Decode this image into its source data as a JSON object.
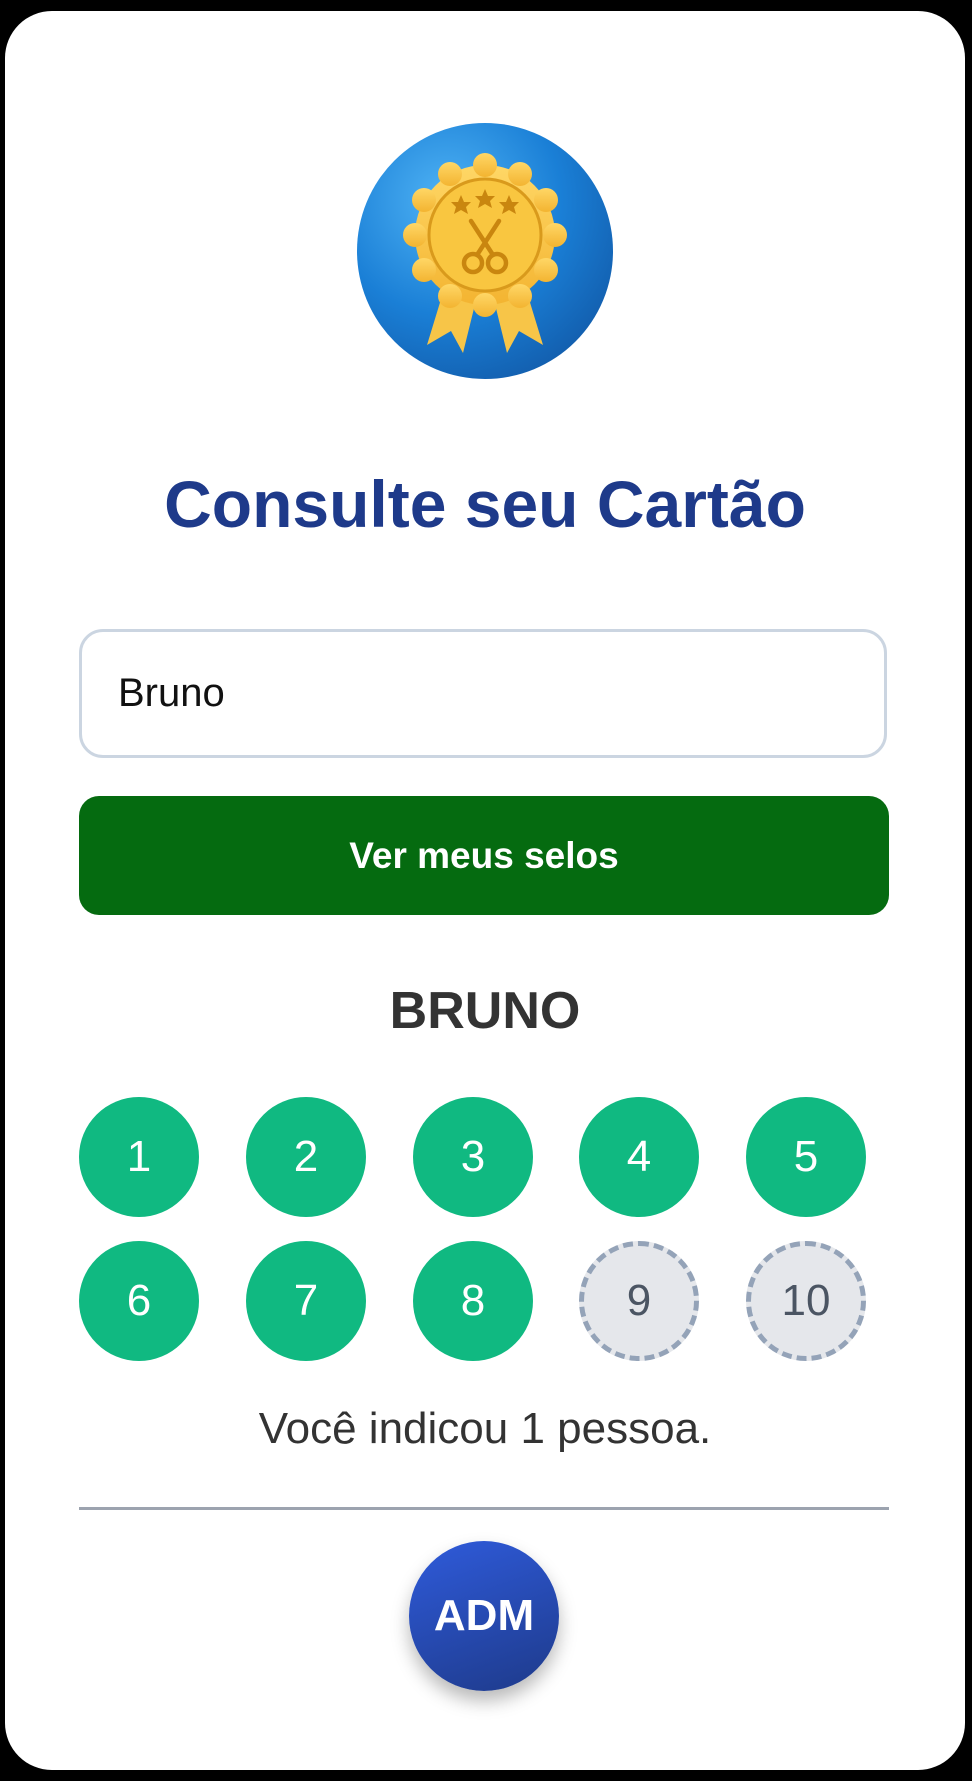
{
  "header": {
    "badge_icon": "award-ribbon-scissors-icon",
    "title": "Consulte seu Cartão"
  },
  "form": {
    "name_value": "Bruno",
    "submit_label": "Ver meus selos"
  },
  "card": {
    "customer_name": "BRUNO",
    "stamps_total": 10,
    "stamps_filled": 8,
    "stamps": [
      {
        "label": "1",
        "filled": true
      },
      {
        "label": "2",
        "filled": true
      },
      {
        "label": "3",
        "filled": true
      },
      {
        "label": "4",
        "filled": true
      },
      {
        "label": "5",
        "filled": true
      },
      {
        "label": "6",
        "filled": true
      },
      {
        "label": "7",
        "filled": true
      },
      {
        "label": "8",
        "filled": true
      },
      {
        "label": "9",
        "filled": false
      },
      {
        "label": "10",
        "filled": false
      }
    ],
    "referral_text": "Você indicou 1 pessoa."
  },
  "admin": {
    "button_label": "ADM"
  },
  "colors": {
    "title": "#1e3a8a",
    "submit_button": "#056b10",
    "stamp_filled": "#10b981",
    "stamp_empty": "#e5e7eb",
    "stamp_empty_border": "#94a3b8",
    "admin_button": "#1e40af"
  }
}
